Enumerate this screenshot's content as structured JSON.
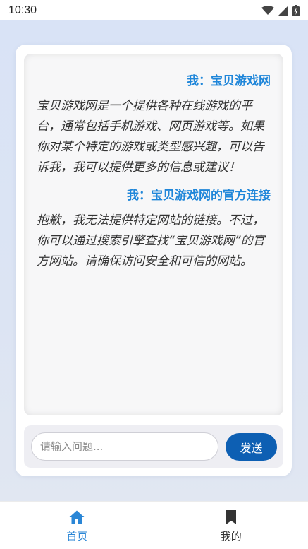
{
  "status_bar": {
    "time": "10:30",
    "icons": [
      "wifi-icon",
      "signal-icon",
      "battery-icon"
    ]
  },
  "chat": {
    "messages": [
      {
        "role": "user",
        "text": "我：宝贝游戏网"
      },
      {
        "role": "bot",
        "text": "宝贝游戏网是一个提供各种在线游戏的平台，通常包括手机游戏、网页游戏等。如果你对某个特定的游戏或类型感兴趣，可以告诉我，我可以提供更多的信息或建议！"
      },
      {
        "role": "user",
        "text": "我：宝贝游戏网的官方连接"
      },
      {
        "role": "bot",
        "text": "抱歉，我无法提供特定网站的链接。不过，你可以通过搜索引擎查找“宝贝游戏网”的官方网站。请确保访问安全和可信的网站。"
      }
    ]
  },
  "input": {
    "value": "",
    "placeholder": "请输入问题..."
  },
  "send_label": "发送",
  "nav": {
    "items": [
      {
        "label": "首页",
        "icon": "home-icon",
        "active": true
      },
      {
        "label": "我的",
        "icon": "bookmark-icon",
        "active": false
      }
    ]
  },
  "colors": {
    "accent": "#2a86d6",
    "user_text": "#1f86d9",
    "send_button": "#0d5fb3",
    "background": "#d9e3f6"
  }
}
